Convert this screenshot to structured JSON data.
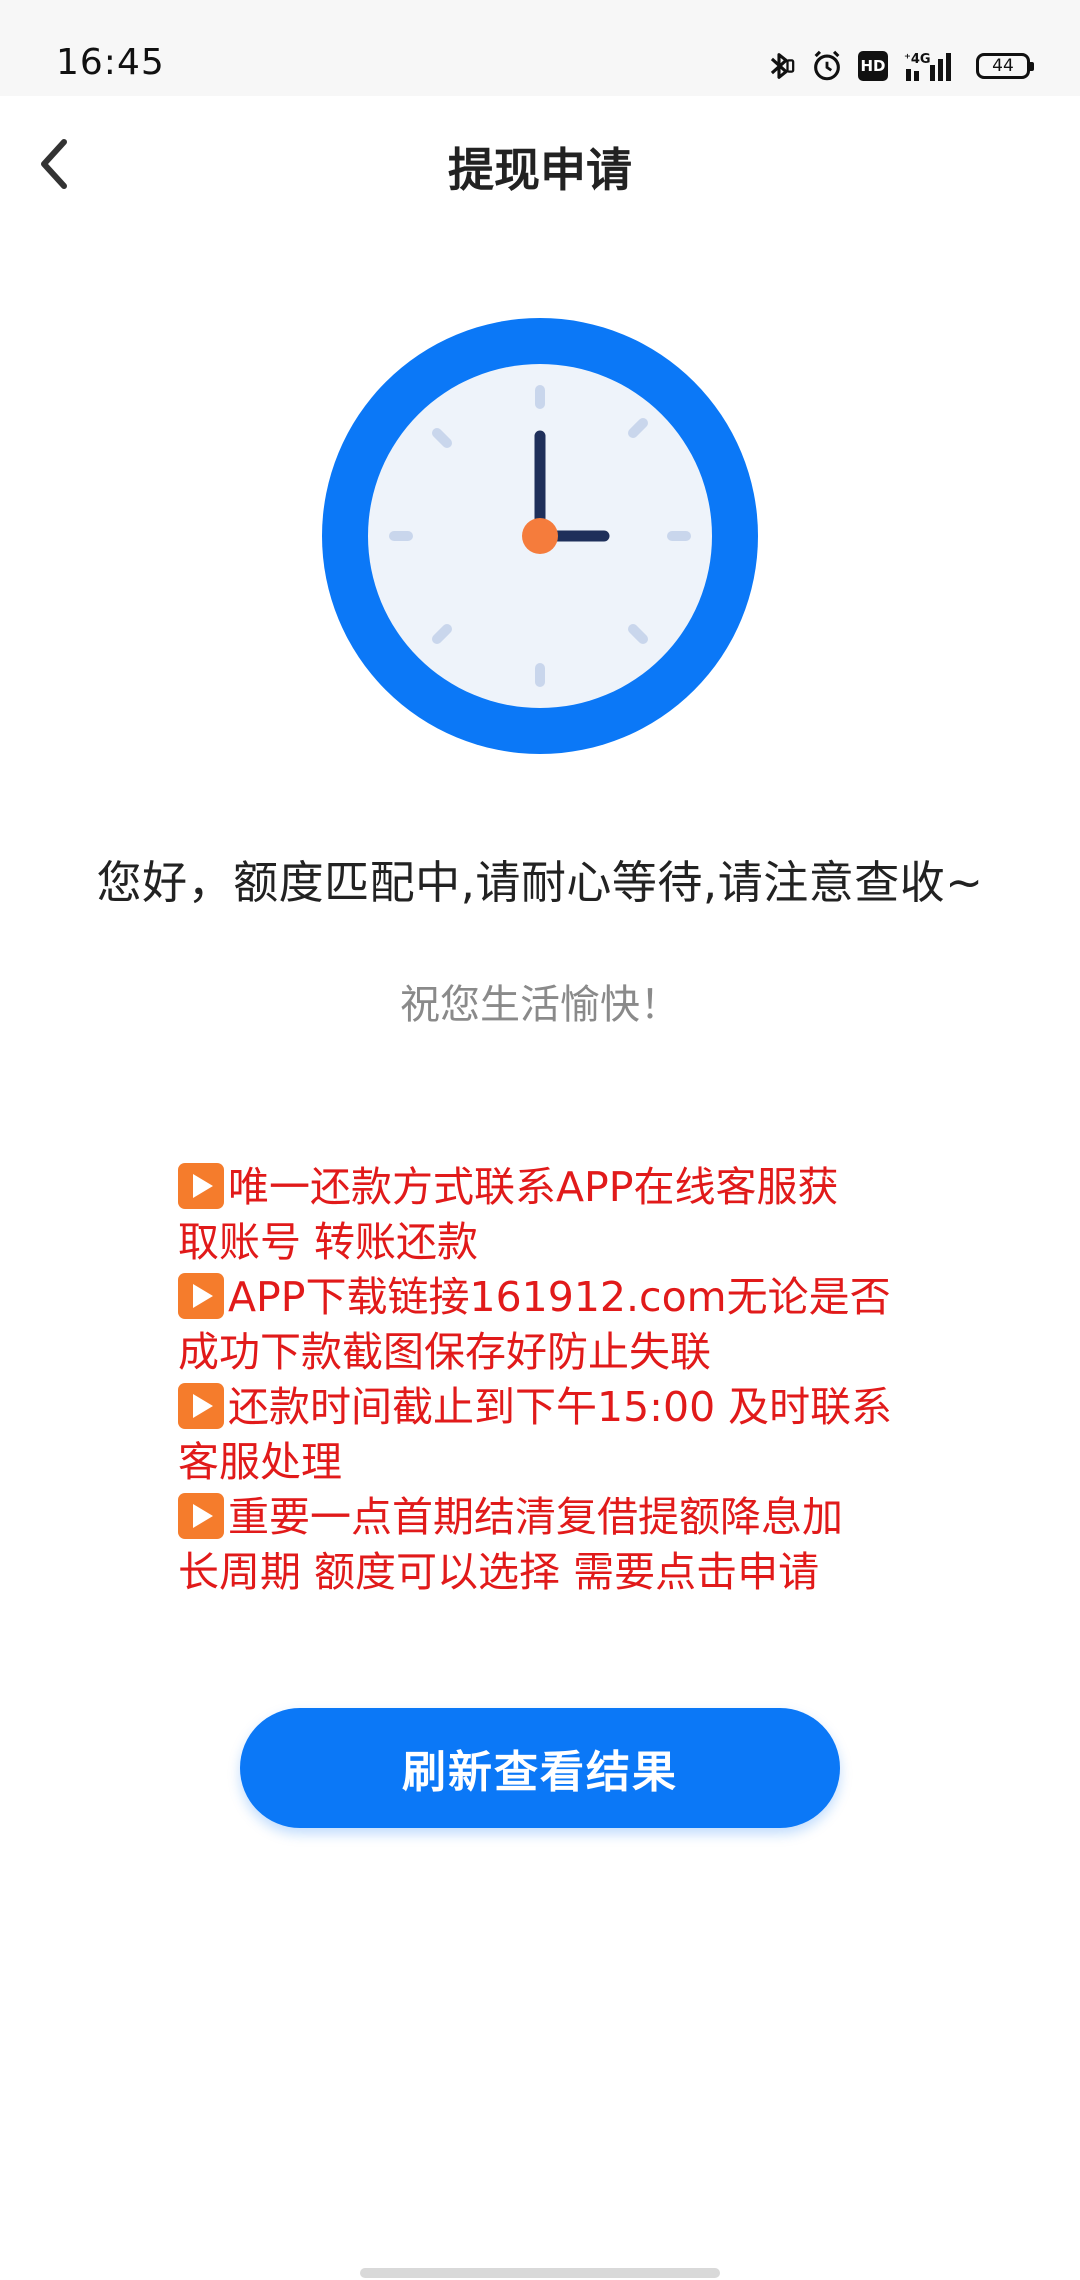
{
  "status_bar": {
    "time": "16:45",
    "network": "4G",
    "hd": "HD",
    "battery": "44",
    "icons": [
      "bluetooth-icon",
      "alarm-icon",
      "hd-icon",
      "signal-icon",
      "battery-icon"
    ]
  },
  "header": {
    "title": "提现申请",
    "back_icon": "chevron-left-icon"
  },
  "clock": {
    "icon": "clock-icon",
    "ring_color": "#0b78f7",
    "face_color": "#eef3fa",
    "hand_color": "#1e2f5a",
    "center_color": "#f57c3c"
  },
  "main": {
    "message": "您好，额度匹配中,请耐心等待,请注意查收~",
    "wish": "祝您生活愉快！"
  },
  "notice": {
    "color": "#e11a1a",
    "lines": [
      "唯一还款方式联系APP在线客服获",
      "取账号  转账还款",
      "APP下载链接161912.com无论是否",
      "成功下款截图保存好防止失联",
      "还款时间截止到下午15:00 及时联系",
      "客服处理",
      "重要一点首期结清复借提额降息加",
      "长周期 额度可以选择 需要点击申请"
    ]
  },
  "button": {
    "label": "刷新查看结果",
    "color": "#0b78f7"
  }
}
